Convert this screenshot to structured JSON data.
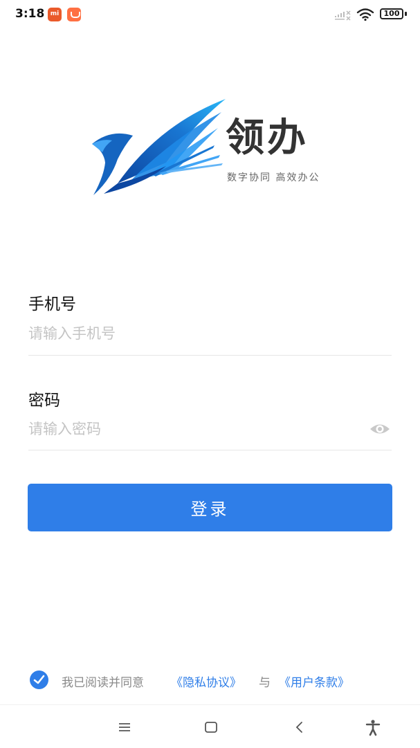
{
  "status_bar": {
    "time": "3:18",
    "badge_mi": "mi",
    "battery": "100",
    "icons": [
      "mi-app-icon",
      "shop-app-icon",
      "signal-x-icon",
      "wifi-icon",
      "battery-icon"
    ]
  },
  "logo": {
    "title": "领办",
    "slogan": "数字协同 高效办公",
    "colors": {
      "brand_blue": "#1565c0",
      "accent_blue": "#1e88e5"
    }
  },
  "form": {
    "phone_label": "手机号",
    "phone_placeholder": "请输入手机号",
    "password_label": "密码",
    "password_placeholder": "请输入密码",
    "login_label": "登录"
  },
  "agreement": {
    "checked": true,
    "prefix": "我已阅读并同意",
    "privacy": "《隐私协议》",
    "and": "与",
    "terms": "《用户条款》"
  },
  "nav_bar": {
    "icons": [
      "menu-icon",
      "home-icon",
      "back-icon",
      "accessibility-icon"
    ]
  },
  "colors": {
    "primary": "#2f7ee8",
    "placeholder": "#c4c4c4",
    "muted_text": "#8a8a8a"
  }
}
